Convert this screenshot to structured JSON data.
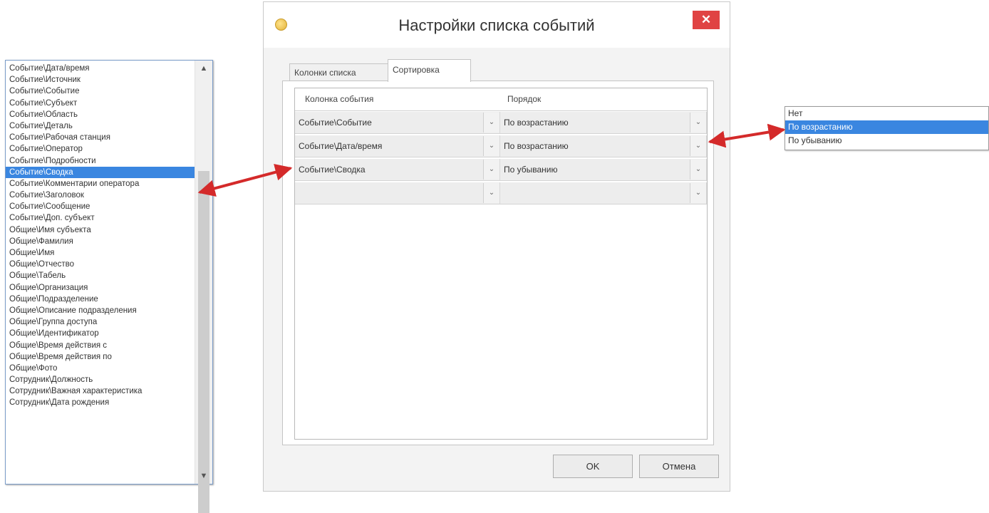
{
  "column_list": {
    "items": [
      "Событие\\Дата/время",
      "Событие\\Источник",
      "Событие\\Событие",
      "Событие\\Субъект",
      "Событие\\Область",
      "Событие\\Деталь",
      "Событие\\Рабочая станция",
      "Событие\\Оператор",
      "Событие\\Подробности",
      "Событие\\Сводка",
      "Событие\\Комментарии оператора",
      "Событие\\Заголовок",
      "Событие\\Сообщение",
      "Событие\\Доп. субъект",
      "Общие\\Имя субъекта",
      "Общие\\Фамилия",
      "Общие\\Имя",
      "Общие\\Отчество",
      "Общие\\Табель",
      "Общие\\Организация",
      "Общие\\Подразделение",
      "Общие\\Описание подразделения",
      "Общие\\Группа доступа",
      "Общие\\Идентификатор",
      "Общие\\Время действия с",
      "Общие\\Время действия по",
      "Общие\\Фото",
      "Сотрудник\\Должность",
      "Сотрудник\\Важная характеристика",
      "Сотрудник\\Дата рождения"
    ],
    "selected_index": 9,
    "scroll_up": "▲",
    "scroll_down": "▼"
  },
  "dialog": {
    "title": "Настройки списка событий",
    "close": "✕",
    "tabs": [
      "Колонки списка",
      "Сортировка"
    ],
    "active_tab": 1,
    "grid": {
      "headers": [
        "Колонка события",
        "Порядок"
      ],
      "rows": [
        {
          "column": "Событие\\Событие",
          "order": "По возрастанию"
        },
        {
          "column": "Событие\\Дата/время",
          "order": "По возрастанию"
        },
        {
          "column": "Событие\\Сводка",
          "order": "По убыванию"
        },
        {
          "column": "",
          "order": ""
        }
      ],
      "dropdown_glyph": "⌄"
    },
    "ok_label": "OK",
    "cancel_label": "Отмена"
  },
  "order_popup": {
    "options": [
      "Нет",
      "По возрастанию",
      "По убыванию"
    ],
    "selected_index": 1
  },
  "colors": {
    "selection": "#3a86e0",
    "close_button": "#e04343",
    "arrow": "#d42a2a"
  }
}
